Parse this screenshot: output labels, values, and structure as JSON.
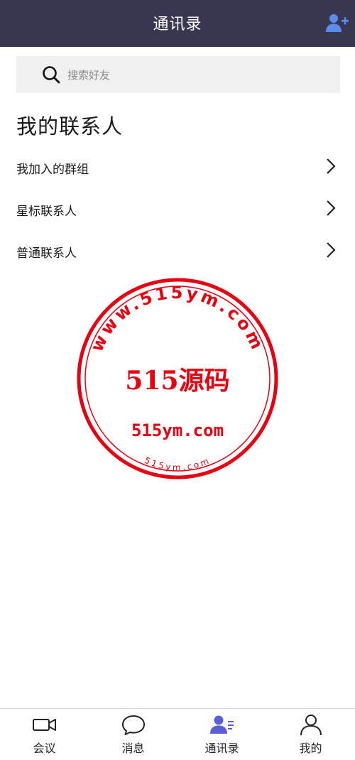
{
  "header": {
    "title": "通讯录",
    "add_icon": "add-contact-icon"
  },
  "search": {
    "placeholder": "搜索好友",
    "icon": "search-icon"
  },
  "section": {
    "title": "我的联系人"
  },
  "list": [
    {
      "label": "我加入的群组"
    },
    {
      "label": "星标联系人"
    },
    {
      "label": "普通联系人"
    }
  ],
  "watermark": {
    "center_text": "515源码",
    "domain_text": "515ym.com",
    "ring_text": "www.515ym.com",
    "small_ring_text": "515ym.com",
    "color": "#e60012"
  },
  "tabs": [
    {
      "label": "会议",
      "icon": "video-camera-icon",
      "active": false
    },
    {
      "label": "消息",
      "icon": "chat-bubble-icon",
      "active": false
    },
    {
      "label": "通讯录",
      "icon": "contacts-icon",
      "active": true
    },
    {
      "label": "我的",
      "icon": "user-icon",
      "active": false
    }
  ],
  "colors": {
    "header_bg": "#383650",
    "accent": "#5a5fd6",
    "add_icon": "#5b8def"
  }
}
